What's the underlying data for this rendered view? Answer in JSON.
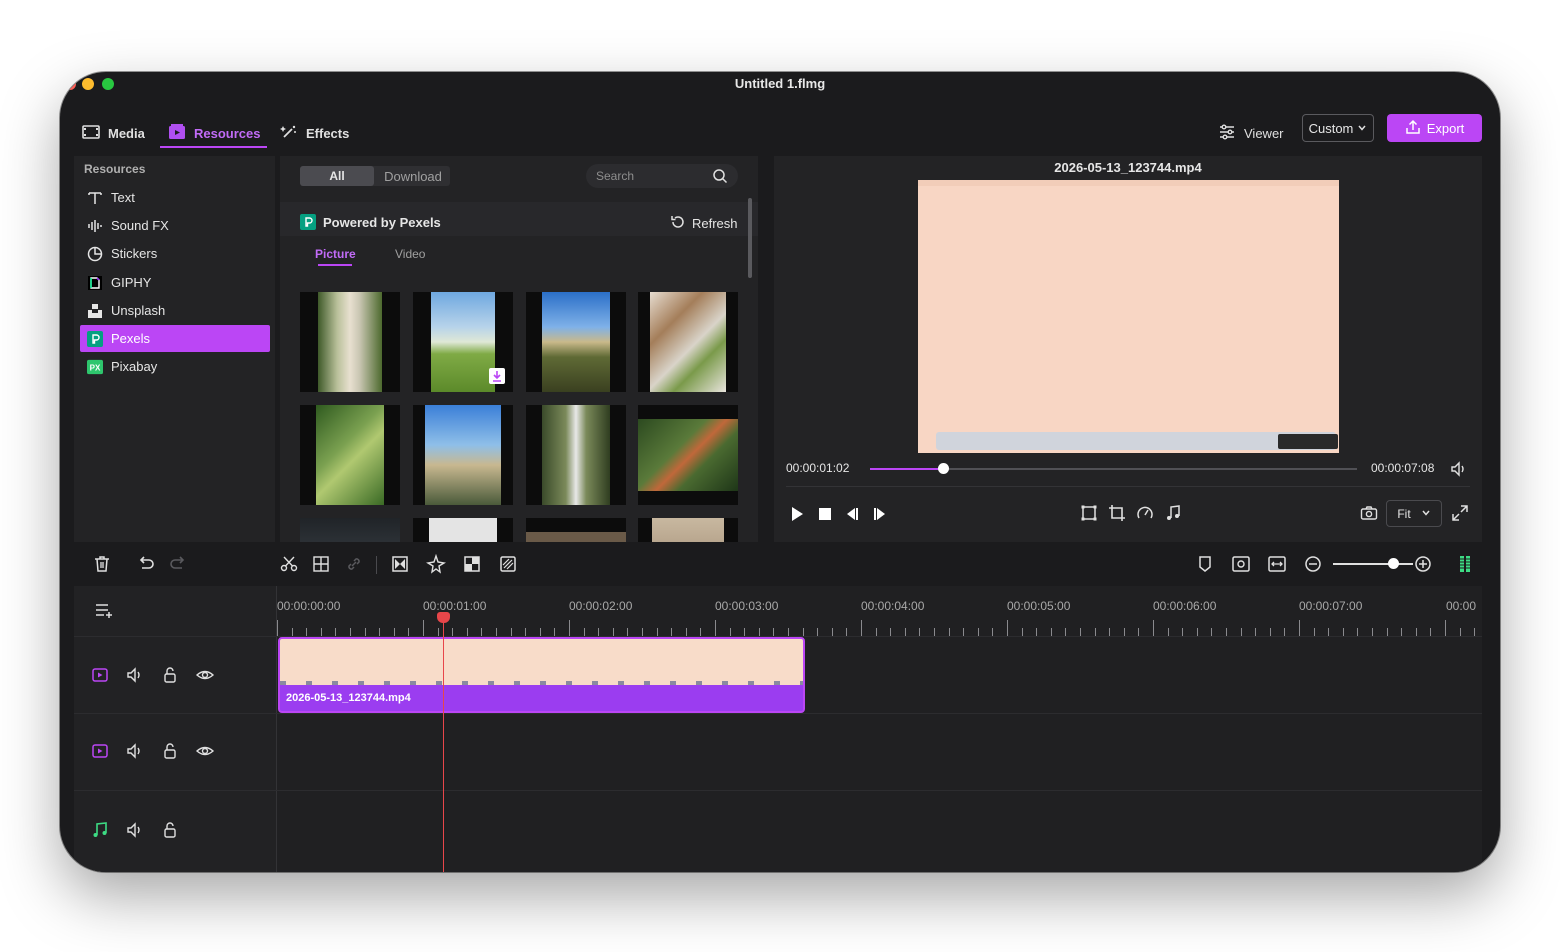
{
  "window": {
    "title": "Untitled 1.flmg"
  },
  "top_tabs": [
    {
      "label": "Media",
      "icon": "film-icon"
    },
    {
      "label": "Resources",
      "icon": "resources-icon"
    },
    {
      "label": "Effects",
      "icon": "magic-wand-icon"
    }
  ],
  "header_right": {
    "viewer_label": "Viewer",
    "layout_select": "Custom",
    "export_label": "Export"
  },
  "sidebar": {
    "heading": "Resources",
    "items": [
      {
        "label": "Text",
        "icon": "text-icon"
      },
      {
        "label": "Sound FX",
        "icon": "waveform-icon"
      },
      {
        "label": "Stickers",
        "icon": "sticker-icon"
      },
      {
        "label": "GIPHY",
        "icon": "giphy-icon"
      },
      {
        "label": "Unsplash",
        "icon": "unsplash-icon"
      },
      {
        "label": "Pexels",
        "icon": "pexels-icon"
      },
      {
        "label": "Pixabay",
        "icon": "pixabay-icon"
      }
    ]
  },
  "library": {
    "segments": [
      "All",
      "Download"
    ],
    "search_placeholder": "Search",
    "provider": "Powered by Pexels",
    "refresh_label": "Refresh",
    "media_tabs": [
      "Picture",
      "Video"
    ]
  },
  "viewer": {
    "file_name": "2026-05-13_123744.mp4",
    "current_time": "00:00:01:02",
    "total_time": "00:00:07:08",
    "progress": 0.15,
    "zoom_select": "Fit"
  },
  "timeline": {
    "ruler_labels": [
      "00:00:00:00",
      "00:00:01:00",
      "00:00:02:00",
      "00:00:03:00",
      "00:00:04:00",
      "00:00:05:00",
      "00:00:06:00",
      "00:00:07:00",
      "00:00"
    ],
    "clip_name": "2026-05-13_123744.mp4",
    "zoom_level": 0.75
  },
  "colors": {
    "accent": "#bb46f5",
    "playhead": "#e8464a",
    "audio": "#3ddc84",
    "clip": "#9b3df0",
    "pexels": "#05a081"
  }
}
